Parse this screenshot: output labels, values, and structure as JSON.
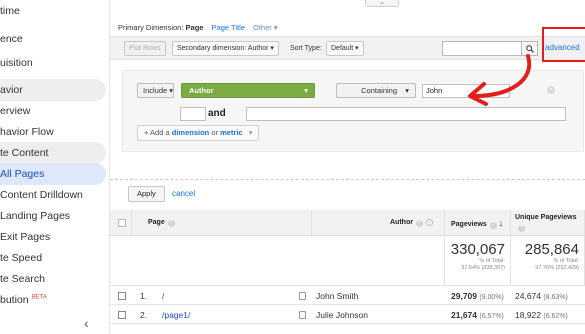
{
  "sidebar": {
    "items": [
      {
        "label": "time",
        "style": "plain"
      },
      {
        "label": "ence",
        "style": "plain"
      },
      {
        "label": "uisition",
        "style": "plain"
      },
      {
        "label": "avior",
        "style": "sec"
      },
      {
        "label": "erview",
        "style": "plain"
      },
      {
        "label": "havior Flow",
        "style": "plain"
      },
      {
        "label": "te Content",
        "style": "sec"
      },
      {
        "label": "All Pages",
        "style": "sel"
      },
      {
        "label": "Content Drilldown",
        "style": "plain"
      },
      {
        "label": "Landing Pages",
        "style": "plain"
      },
      {
        "label": "Exit Pages",
        "style": "plain"
      },
      {
        "label": "te Speed",
        "style": "plain"
      },
      {
        "label": "te Search",
        "style": "plain"
      },
      {
        "label": "bution",
        "style": "plain",
        "badge": "BETA"
      }
    ],
    "collapse_icon": "chevron-left-icon",
    "collapse_glyph": "‹"
  },
  "primary_dimension": {
    "label": "Primary Dimension:",
    "current": "Page",
    "alt": "Page Title",
    "other": "Other ▾"
  },
  "toolbar": {
    "plot_rows": "Plot Rows",
    "secondary_dimension": "Secondary dimension: Author",
    "sort_label": "Sort Type:",
    "sort_value": "Default",
    "search_value": "",
    "advanced": "advanced"
  },
  "filter": {
    "include": "Include",
    "dimension": "Author",
    "match": "Containing",
    "value": "John",
    "and": "and",
    "add_prefix": "+ Add a ",
    "add_dimension": "dimension",
    "add_or": " or ",
    "add_metric": "metric"
  },
  "actions": {
    "apply": "Apply",
    "cancel": "cancel"
  },
  "table": {
    "headers": {
      "page": "Page",
      "author": "Author",
      "pageviews": "Pageviews",
      "unique_pageviews": "Unique Pageviews"
    },
    "totals": {
      "pageviews": "330,067",
      "pageviews_pct": "% of Total:",
      "pageviews_of": "97.54% (338,397)",
      "unique": "285,864",
      "unique_pct": "% of Total:",
      "unique_of": "97.76% (292,428)"
    },
    "rows": [
      {
        "index": "1.",
        "page": "/",
        "author": "John Smith",
        "pageviews": "29,709",
        "pageviews_pct": "(9.00%)",
        "unique": "24,674",
        "unique_pct": "(8.63%)"
      },
      {
        "index": "2.",
        "page": "/page1/",
        "author": "Julie Johnson",
        "pageviews": "21,674",
        "pageviews_pct": "(6.57%)",
        "unique": "18,922",
        "unique_pct": "(6.62%)"
      }
    ]
  },
  "colors": {
    "accent": "#1a73e8",
    "author_chip": "#7bab42",
    "annotation": "#e0201b",
    "selected_nav": "#dfe7fb"
  }
}
